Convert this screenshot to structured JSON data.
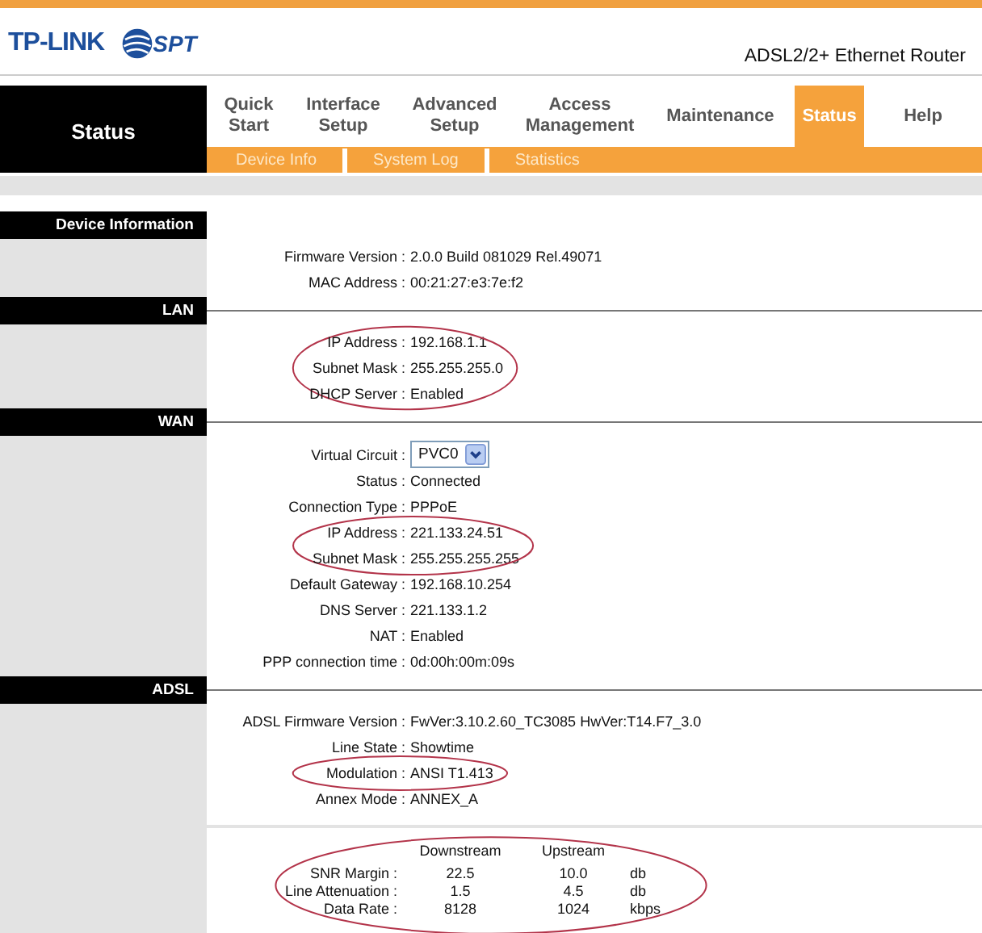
{
  "header": {
    "logo": "TP-LINK",
    "partner_logo": "SPT",
    "product": "ADSL2/2+ Ethernet Router"
  },
  "nav": {
    "section_title": "Status",
    "tabs": [
      {
        "label": "Quick Start",
        "selected": false
      },
      {
        "label": "Interface Setup",
        "selected": false
      },
      {
        "label": "Advanced Setup",
        "selected": false
      },
      {
        "label": "Access Management",
        "selected": false
      },
      {
        "label": "Maintenance",
        "selected": false
      },
      {
        "label": "Status",
        "selected": true
      },
      {
        "label": "Help",
        "selected": false
      }
    ],
    "subtabs": [
      {
        "label": "Device Info"
      },
      {
        "label": "System Log"
      },
      {
        "label": "Statistics"
      }
    ]
  },
  "sections": [
    {
      "title": "Device Information",
      "groups": [
        {
          "rows": [
            {
              "kind": "text",
              "label": "Firmware Version :",
              "value": "2.0.0 Build 081029 Rel.49071"
            },
            {
              "kind": "text",
              "label": "MAC Address :",
              "value": "00:21:27:e3:7e:f2"
            }
          ]
        }
      ]
    },
    {
      "title": "LAN",
      "groups": [
        {
          "circled": true,
          "rows": [
            {
              "kind": "text",
              "label": "IP Address :",
              "value": "192.168.1.1"
            },
            {
              "kind": "text",
              "label": "Subnet Mask :",
              "value": "255.255.255.0"
            },
            {
              "kind": "text",
              "label": "DHCP Server :",
              "value": "Enabled"
            }
          ]
        }
      ]
    },
    {
      "title": "WAN",
      "groups": [
        {
          "rows": [
            {
              "kind": "select",
              "label": "Virtual Circuit :",
              "value": "PVC0"
            },
            {
              "kind": "text",
              "label": "Status :",
              "value": "Connected"
            },
            {
              "kind": "text",
              "label": "Connection Type :",
              "value": "PPPoE"
            }
          ]
        },
        {
          "circled": true,
          "rows": [
            {
              "kind": "text",
              "label": "IP Address :",
              "value": "221.133.24.51"
            },
            {
              "kind": "text",
              "label": "Subnet Mask :",
              "value": "255.255.255.255"
            }
          ]
        },
        {
          "rows": [
            {
              "kind": "text",
              "label": "Default Gateway :",
              "value": "192.168.10.254"
            },
            {
              "kind": "text",
              "label": "DNS Server :",
              "value": "221.133.1.2"
            },
            {
              "kind": "text",
              "label": "NAT :",
              "value": "Enabled"
            },
            {
              "kind": "text",
              "label": "PPP connection time :",
              "value": "0d:00h:00m:09s"
            }
          ]
        }
      ]
    },
    {
      "title": "ADSL",
      "groups": [
        {
          "rows": [
            {
              "kind": "text",
              "label": "ADSL Firmware Version :",
              "value": "FwVer:3.10.2.60_TC3085 HwVer:T14.F7_3.0"
            },
            {
              "kind": "text",
              "label": "Line State :",
              "value": "Showtime"
            }
          ]
        },
        {
          "circled": true,
          "rows": [
            {
              "kind": "text",
              "label": "Modulation :",
              "value": "ANSI T1.413"
            }
          ]
        },
        {
          "rows": [
            {
              "kind": "text",
              "label": "Annex Mode :",
              "value": "ANNEX_A"
            }
          ]
        }
      ],
      "stats": {
        "circled": true,
        "columns": [
          "Downstream",
          "Upstream"
        ],
        "rows": [
          {
            "label": "SNR Margin :",
            "down": "22.5",
            "up": "10.0",
            "unit": "db"
          },
          {
            "label": "Line Attenuation :",
            "down": "1.5",
            "up": "4.5",
            "unit": "db"
          },
          {
            "label": "Data Rate :",
            "down": "8128",
            "up": "1024",
            "unit": "kbps"
          }
        ]
      }
    }
  ]
}
